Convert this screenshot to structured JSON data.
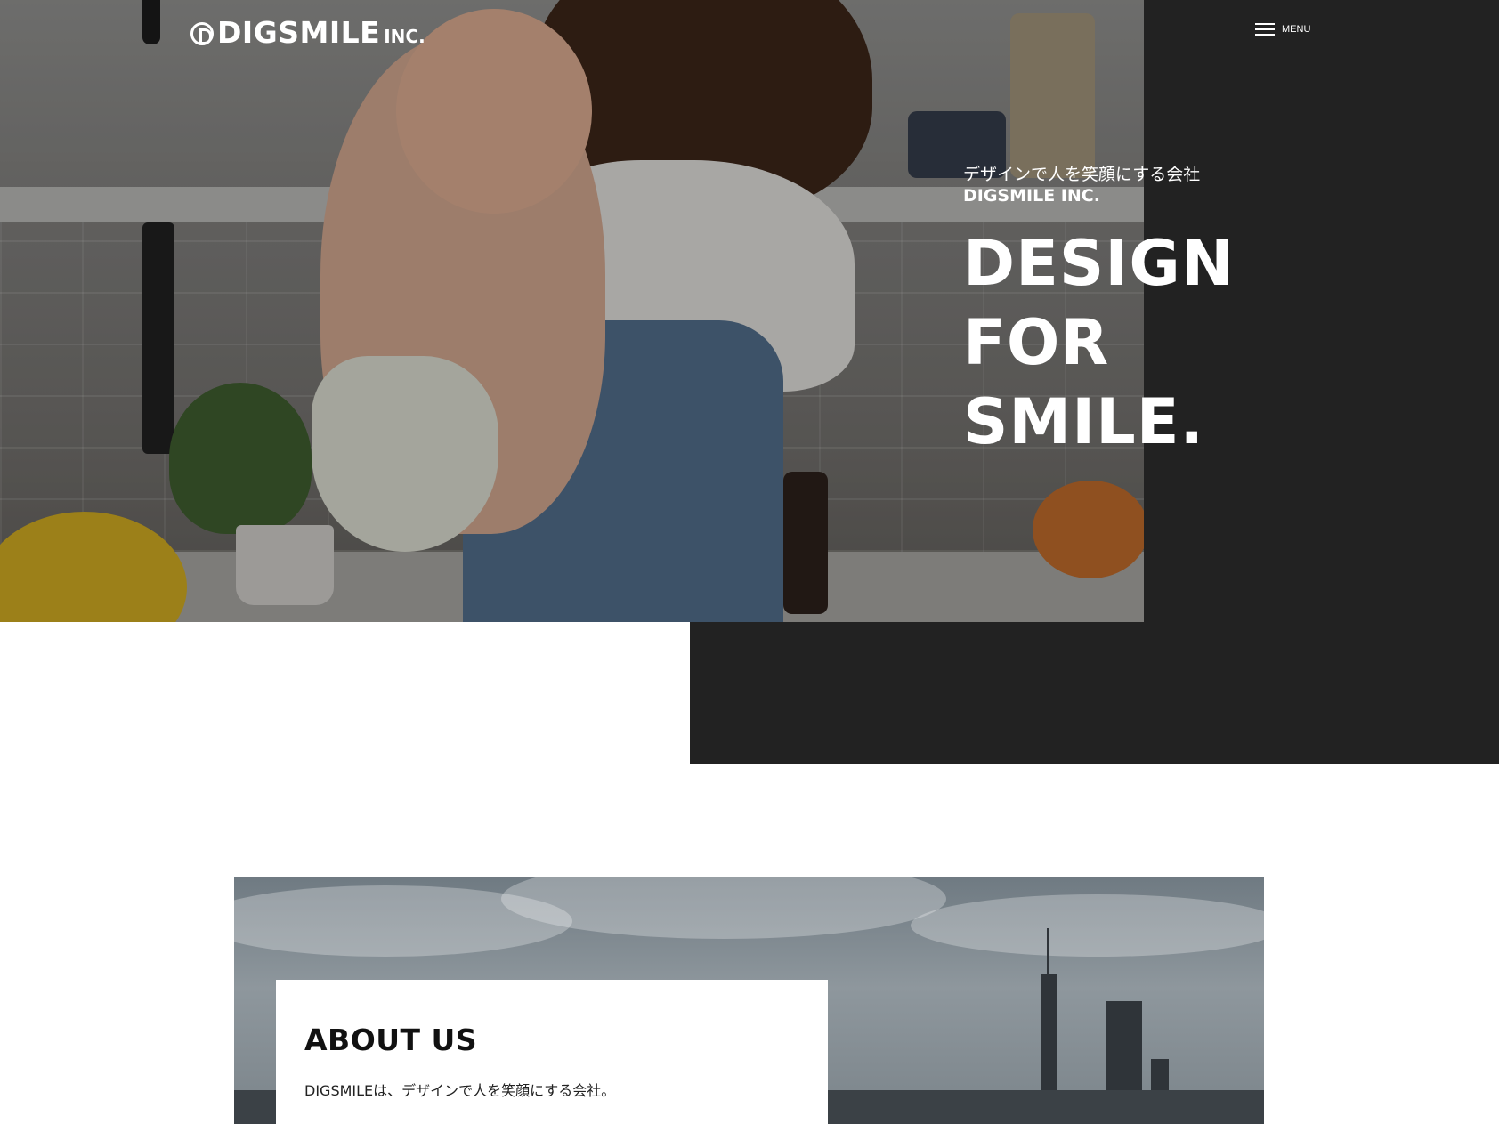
{
  "header": {
    "logo_name": "DIGSMILE",
    "logo_suffix": "INC.",
    "menu_label": "MENU"
  },
  "hero": {
    "tagline_jp": "デザインで人を笑顔にする会社",
    "company": "DIGSMILE INC.",
    "title_lines": [
      "DESIGN",
      "FOR",
      "SMILE."
    ]
  },
  "about": {
    "title": "ABOUT US",
    "intro": "DIGSMILEは、デザインで人を笑顔にする会社。"
  },
  "colors": {
    "dark_panel": "#222222",
    "text_light": "#ffffff",
    "text_dark": "#111111"
  },
  "icons": {
    "menu": "hamburger-icon",
    "logo": "digsmile-logo-mark"
  }
}
